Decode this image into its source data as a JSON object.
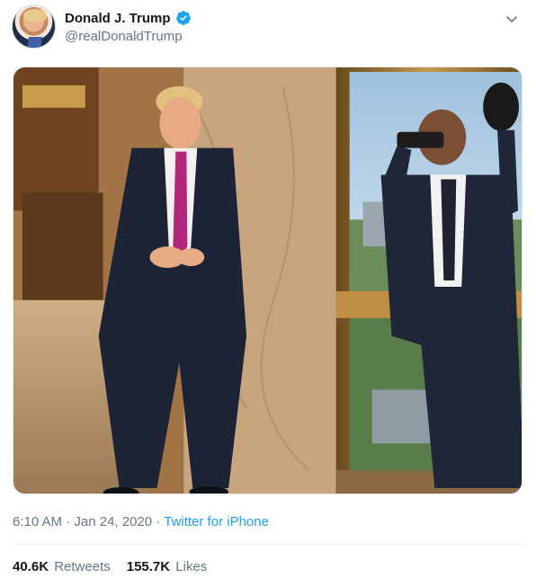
{
  "author": {
    "display_name": "Donald J. Trump",
    "handle": "@realDonaldTrump",
    "avatar_icon": "profile-avatar",
    "verified_icon": "verified-badge-icon"
  },
  "menu": {
    "icon": "chevron-down-icon"
  },
  "media": {
    "icon": "tweet-photo"
  },
  "meta": {
    "time": "6:10 AM",
    "date": "Jan 24, 2020",
    "separator": "·",
    "source": "Twitter for iPhone"
  },
  "stats": {
    "retweets_count": "40.6K",
    "retweets_label": "Retweets",
    "likes_count": "155.7K",
    "likes_label": "Likes"
  },
  "colors": {
    "link": "#1da1f2",
    "secondary_text": "#657786",
    "primary_text": "#14171a",
    "divider": "#e6ecf0"
  }
}
